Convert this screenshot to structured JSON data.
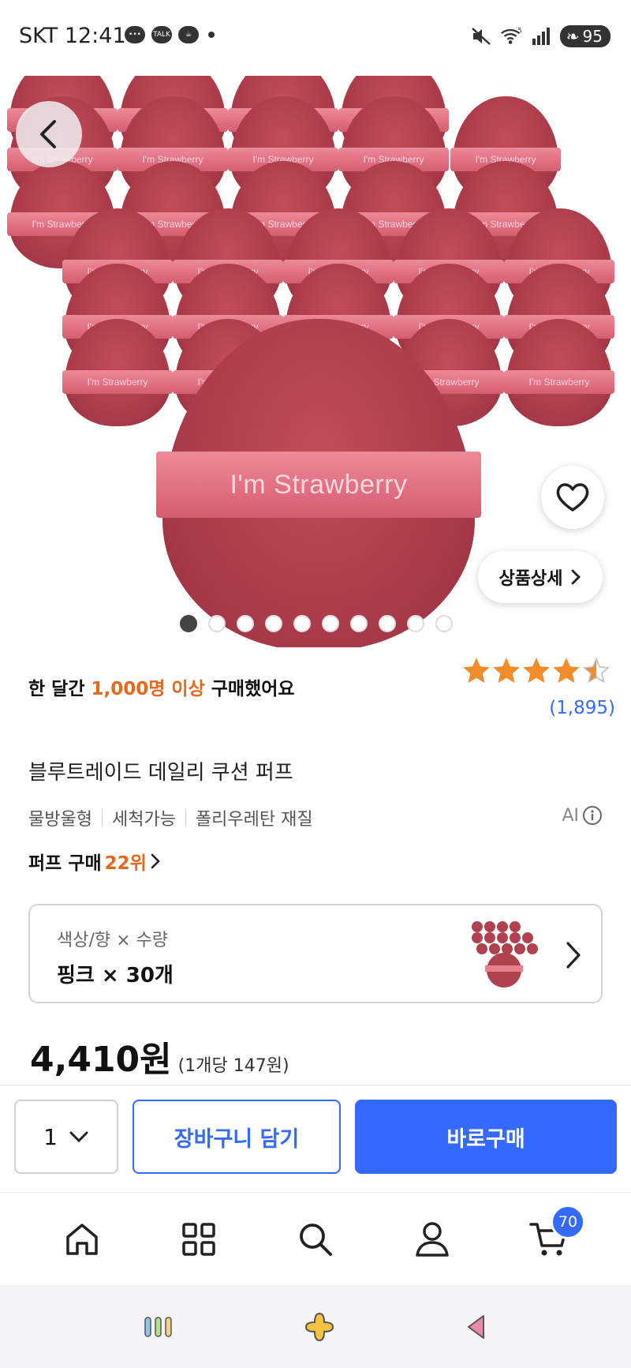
{
  "status_bar": {
    "carrier_time": "SKT 12:41",
    "talk_label": "TALK",
    "wifi_label": "5",
    "battery": "95"
  },
  "hero": {
    "brand_text": "I'm Strawberry",
    "image_count": 10,
    "active_index": 0,
    "detail_button": "상품상세"
  },
  "summary": {
    "purchase_prefix": "한 달간 ",
    "purchase_highlight": "1,000명 이상",
    "purchase_suffix": " 구매했어요",
    "rating": 4.5,
    "review_count": "(1,895)"
  },
  "product": {
    "title": "블루트레이드 데일리 쿠션 퍼프",
    "tags": [
      "물방울형",
      "세척가능",
      "폴리우레탄 재질"
    ],
    "ai_label": "AI",
    "rank_prefix": "퍼프 구매 ",
    "rank_highlight": "22위"
  },
  "option": {
    "label": "색상/향 × 수량",
    "value": "핑크 × 30개"
  },
  "price": {
    "amount": "4,410원",
    "unit": "(1개당 147원)"
  },
  "buybar": {
    "quantity": "1",
    "cart_label": "장바구니 담기",
    "buy_label": "바로구매"
  },
  "nav": {
    "cart_badge": "70",
    "items": [
      "home-icon",
      "category-icon",
      "search-icon",
      "my-icon",
      "cart-icon"
    ]
  },
  "colors": {
    "accent_blue": "#346aff",
    "highlight_orange": "#e5691c",
    "star": "#f08c2a",
    "puff": "#a83948",
    "band": "#e06e80"
  }
}
